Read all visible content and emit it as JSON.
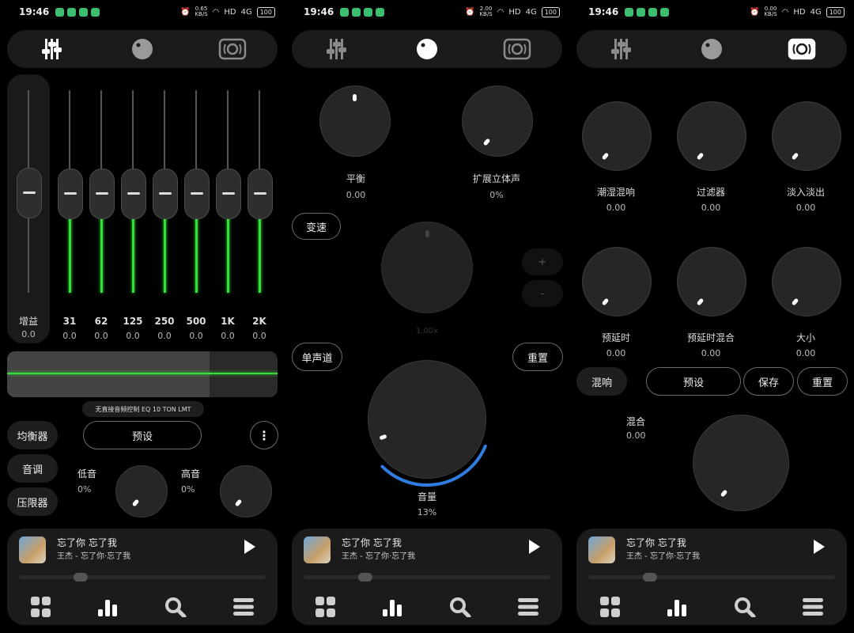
{
  "status": {
    "time": "19:46",
    "panels": [
      {
        "speed_top": "0.65",
        "speed_bottom": "KB/S",
        "hd": "HD",
        "signal": "4G",
        "battery": "100"
      },
      {
        "speed_top": "2.00",
        "speed_bottom": "KB/S",
        "hd": "HD",
        "signal": "4G",
        "battery": "100"
      },
      {
        "speed_top": "0.00",
        "speed_bottom": "KB/S",
        "hd": "HD",
        "signal": "4G",
        "battery": "100"
      }
    ]
  },
  "tabs": [
    "equalizer-icon",
    "knob-icon",
    "speaker-icon"
  ],
  "eq": {
    "gain_label": "增益",
    "gain_value": "0.0",
    "bands": [
      {
        "freq": "31",
        "value": "0.0"
      },
      {
        "freq": "62",
        "value": "0.0"
      },
      {
        "freq": "125",
        "value": "0.0"
      },
      {
        "freq": "250",
        "value": "0.0"
      },
      {
        "freq": "500",
        "value": "0.0"
      },
      {
        "freq": "1K",
        "value": "0.0"
      },
      {
        "freq": "2K",
        "value": "0.0"
      }
    ],
    "device_label": "无直接音频控制 EQ 10 TON LMT",
    "side_buttons": [
      "均衡器",
      "音调",
      "压限器"
    ],
    "preset_button": "预设",
    "bass_label": "低音",
    "bass_value": "0%",
    "treble_label": "高音",
    "treble_value": "0%"
  },
  "fx": {
    "balance_label": "平衡",
    "balance_value": "0.00",
    "stereo_label": "扩展立体声",
    "stereo_value": "0%",
    "tempo_button": "变速",
    "tempo_value": "1.00x",
    "plus": "+",
    "minus": "-",
    "mono_button": "单声道",
    "reset_button": "重置",
    "volume_label": "音量",
    "volume_value": "13%",
    "volume_fraction": 0.13
  },
  "reverb": {
    "knobs": [
      {
        "label": "潮湿混响",
        "value": "0.00"
      },
      {
        "label": "过滤器",
        "value": "0.00"
      },
      {
        "label": "淡入淡出",
        "value": "0.00"
      },
      {
        "label": "预延时",
        "value": "0.00"
      },
      {
        "label": "预延时混合",
        "value": "0.00"
      },
      {
        "label": "大小",
        "value": "0.00"
      }
    ],
    "reverb_button": "混响",
    "preset_button": "预设",
    "save_button": "保存",
    "reset_button": "重置",
    "mix_label": "混合",
    "mix_value": "0.00"
  },
  "player": {
    "title": "忘了你 忘了我",
    "artist": "王杰 - 忘了你·忘了我",
    "progress_fraction": 0.22
  },
  "nav": [
    "grid-icon",
    "bars-icon",
    "search-icon",
    "menu-icon"
  ],
  "colors": {
    "accent_green": "#35e03a",
    "volume_blue": "#2f7de1"
  }
}
